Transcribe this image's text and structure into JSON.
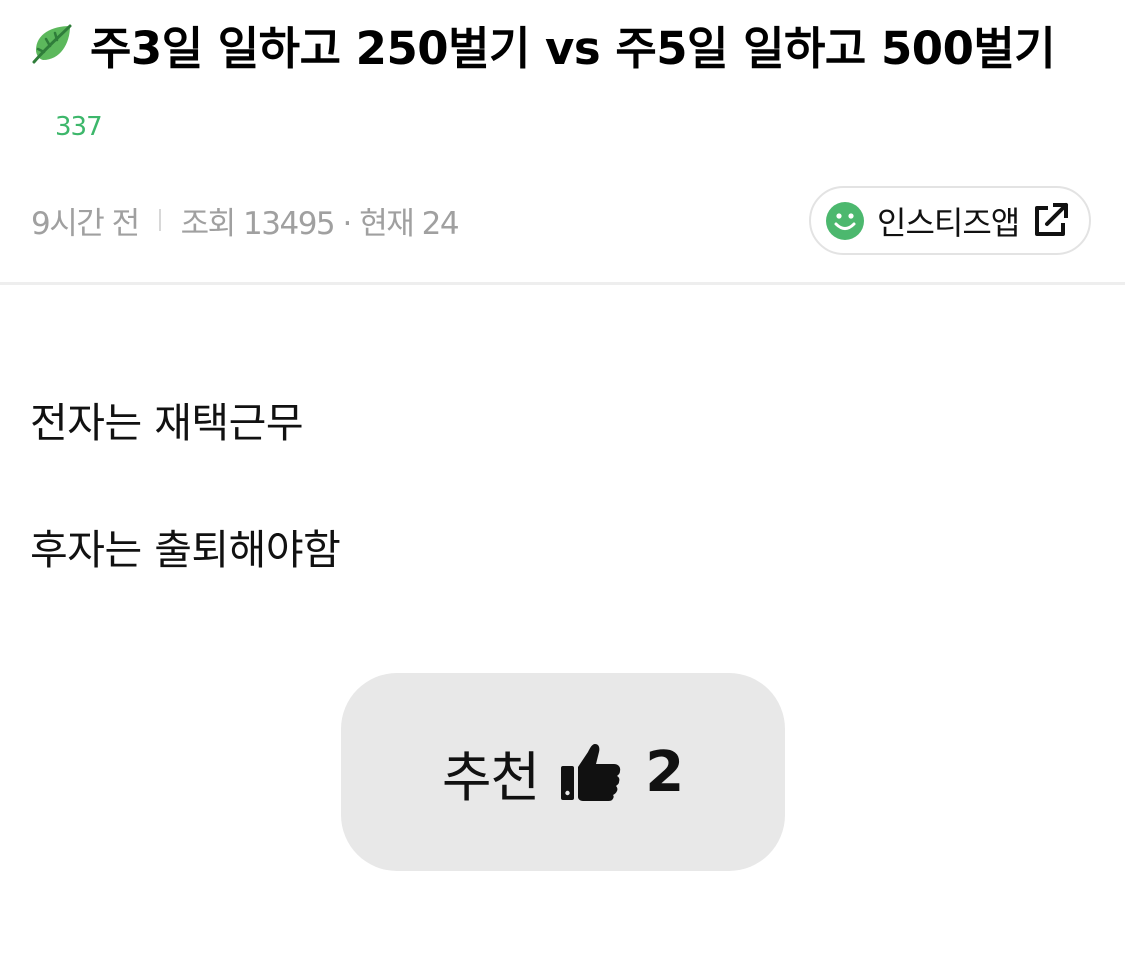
{
  "post": {
    "title_icon": "leaf-icon",
    "title": "주3일 일하고 250벌기 vs 주5일 일하고 500벌기",
    "comment_count": "337",
    "time_ago": "9시간 전",
    "views": "조회 13495 · 현재 24",
    "body": [
      "전자는 재택근무",
      "후자는 출퇴해야함"
    ]
  },
  "app_button": {
    "label": "인스티즈앱",
    "icon_left": "smile-icon",
    "icon_right": "external-link-icon"
  },
  "recommend": {
    "label": "추천",
    "icon": "thumbs-up-icon",
    "count": "2"
  },
  "colors": {
    "accent_green": "#3db76b",
    "meta_gray": "#a0a0a0",
    "button_bg": "#e8e8e8"
  }
}
